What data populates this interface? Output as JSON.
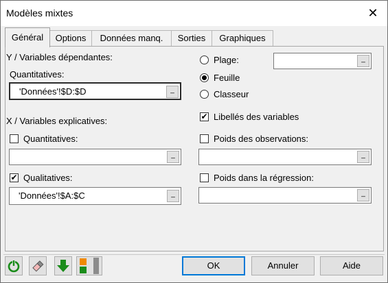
{
  "window": {
    "title": "Modèles mixtes"
  },
  "tabs": [
    {
      "label": "Général",
      "active": true
    },
    {
      "label": "Options",
      "active": false
    },
    {
      "label": "Données manq.",
      "active": false
    },
    {
      "label": "Sorties",
      "active": false
    },
    {
      "label": "Graphiques",
      "active": false
    }
  ],
  "y_section": {
    "heading": "Y / Variables dépendantes:",
    "quant_label": "Quantitatives:",
    "quant_value": "'Données'!$D:$D"
  },
  "x_section": {
    "heading": "X / Variables explicatives:",
    "quant_label": "Quantitatives:",
    "quant_checked": false,
    "quant_value": "",
    "qual_label": "Qualitatives:",
    "qual_checked": true,
    "qual_value": "'Données'!$A:$C"
  },
  "location": {
    "plage_label": "Plage:",
    "plage_value": "",
    "feuille_label": "Feuille",
    "classeur_label": "Classeur",
    "selected": "Feuille"
  },
  "options": {
    "libelles_label": "Libellés des variables",
    "libelles_checked": true,
    "poids_obs_label": "Poids des observations:",
    "poids_obs_checked": false,
    "poids_obs_value": "",
    "poids_reg_label": "Poids dans la régression:",
    "poids_reg_checked": false,
    "poids_reg_value": ""
  },
  "footer": {
    "ok_label": "OK",
    "cancel_label": "Annuler",
    "help_label": "Aide",
    "icons": [
      "reset-icon",
      "eraser-icon",
      "download-arrow-icon",
      "layout-toggle-icon"
    ]
  },
  "colors": {
    "accent": "#0078d7",
    "green": "#1a8c1a",
    "orange": "#f08a00"
  }
}
